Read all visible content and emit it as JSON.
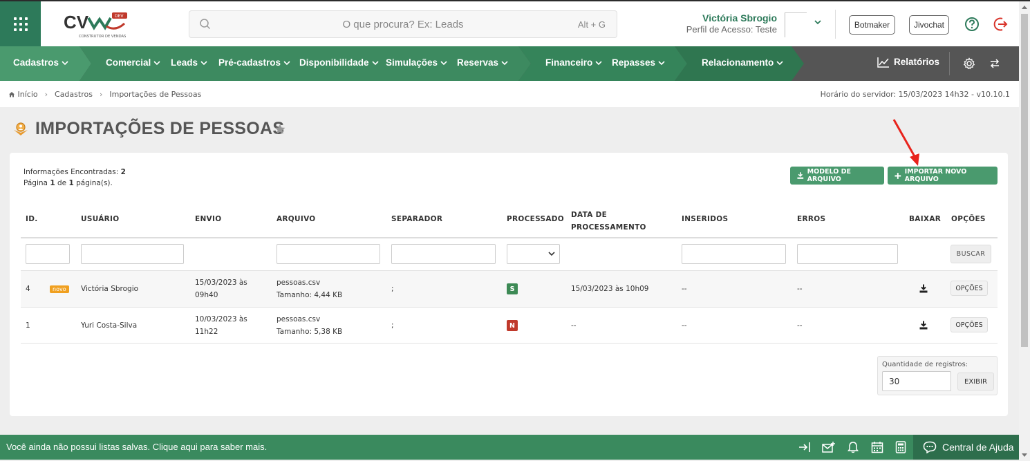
{
  "brand": {
    "logo_text": "CV",
    "logo_badge": "DEV",
    "logo_tagline": "CONSTRUTOR DE VENDAS",
    "primary_color": "#2d7a5a",
    "accent_color": "#4a9a6e"
  },
  "search": {
    "placeholder": "O que procura? Ex: Leads",
    "shortcut": "Alt + G"
  },
  "user": {
    "name": "Victória Sbrogio",
    "profile": "Perfil de Acesso: Teste"
  },
  "header_buttons": {
    "botmaker": "Botmaker",
    "jivochat": "Jivochat"
  },
  "nav": {
    "items": [
      {
        "label": "Cadastros"
      },
      {
        "label": "Comercial"
      },
      {
        "label": "Leads"
      },
      {
        "label": "Pré-cadastros"
      },
      {
        "label": "Disponibilidade"
      },
      {
        "label": "Simulações"
      },
      {
        "label": "Reservas"
      },
      {
        "label": "Financeiro"
      },
      {
        "label": "Repasses"
      },
      {
        "label": "Relacionamento"
      }
    ],
    "reports": "Relatórios"
  },
  "breadcrumb": {
    "home": "Início",
    "section": "Cadastros",
    "current": "Importações de Pessoas"
  },
  "server_time": "Horário do servidor: 15/03/2023 14h32 - v10.10.1",
  "page": {
    "title": "IMPORTAÇÕES DE PESSOAS"
  },
  "info": {
    "found_label": "Informações Encontradas:",
    "found_count": "2",
    "page_label": "Página",
    "page_current": "1",
    "page_of": "de",
    "page_total": "1",
    "page_suffix": "página(s)."
  },
  "buttons": {
    "modelo": "MODELO DE ARQUIVO",
    "importar": "IMPORTAR NOVO ARQUIVO",
    "buscar": "BUSCAR",
    "opcoes": "OPÇÕES",
    "exibir": "EXIBIR"
  },
  "table": {
    "headers": {
      "id": "ID.",
      "usuario": "USUÁRIO",
      "envio": "ENVIO",
      "arquivo": "ARQUIVO",
      "separador": "SEPARADOR",
      "processado": "PROCESSADO",
      "data_proc_1": "DATA DE",
      "data_proc_2": "PROCESSAMENTO",
      "inseridos": "INSERIDOS",
      "erros": "ERROS",
      "baixar": "BAIXAR",
      "opcoes": "OPÇÕES"
    },
    "rows": [
      {
        "id": "4",
        "badge": "novo",
        "usuario": "Victória Sbrogio",
        "envio_1": "15/03/2023 às",
        "envio_2": "09h40",
        "arquivo": "pessoas.csv",
        "tamanho": "Tamanho: 4,44 KB",
        "separador": ";",
        "processado": "S",
        "data_proc": "15/03/2023 às 10h09",
        "inseridos": "--",
        "erros": "--"
      },
      {
        "id": "1",
        "badge": "",
        "usuario": "Yuri Costa-Silva",
        "envio_1": "10/03/2023 às",
        "envio_2": "11h22",
        "arquivo": "pessoas.csv",
        "tamanho": "Tamanho: 5,38 KB",
        "separador": ";",
        "processado": "N",
        "data_proc": "--",
        "inseridos": "--",
        "erros": "--"
      }
    ]
  },
  "records": {
    "label": "Quantidade de registros:",
    "value": "30"
  },
  "footer": {
    "message": "Você ainda não possui listas salvas. Clique aqui para saber mais.",
    "help": "Central de Ajuda"
  },
  "icons": [
    "grid-icon",
    "search-icon",
    "chevron-down-icon",
    "help-icon",
    "exit-icon",
    "chart-icon",
    "gear-icon",
    "swap-icon",
    "home-icon",
    "star-icon",
    "import-people-icon",
    "download-icon",
    "plus-icon",
    "select-caret-icon",
    "login-icon",
    "mail-add-icon",
    "bell-icon",
    "calendar-icon",
    "calculator-icon",
    "chat-icon"
  ]
}
